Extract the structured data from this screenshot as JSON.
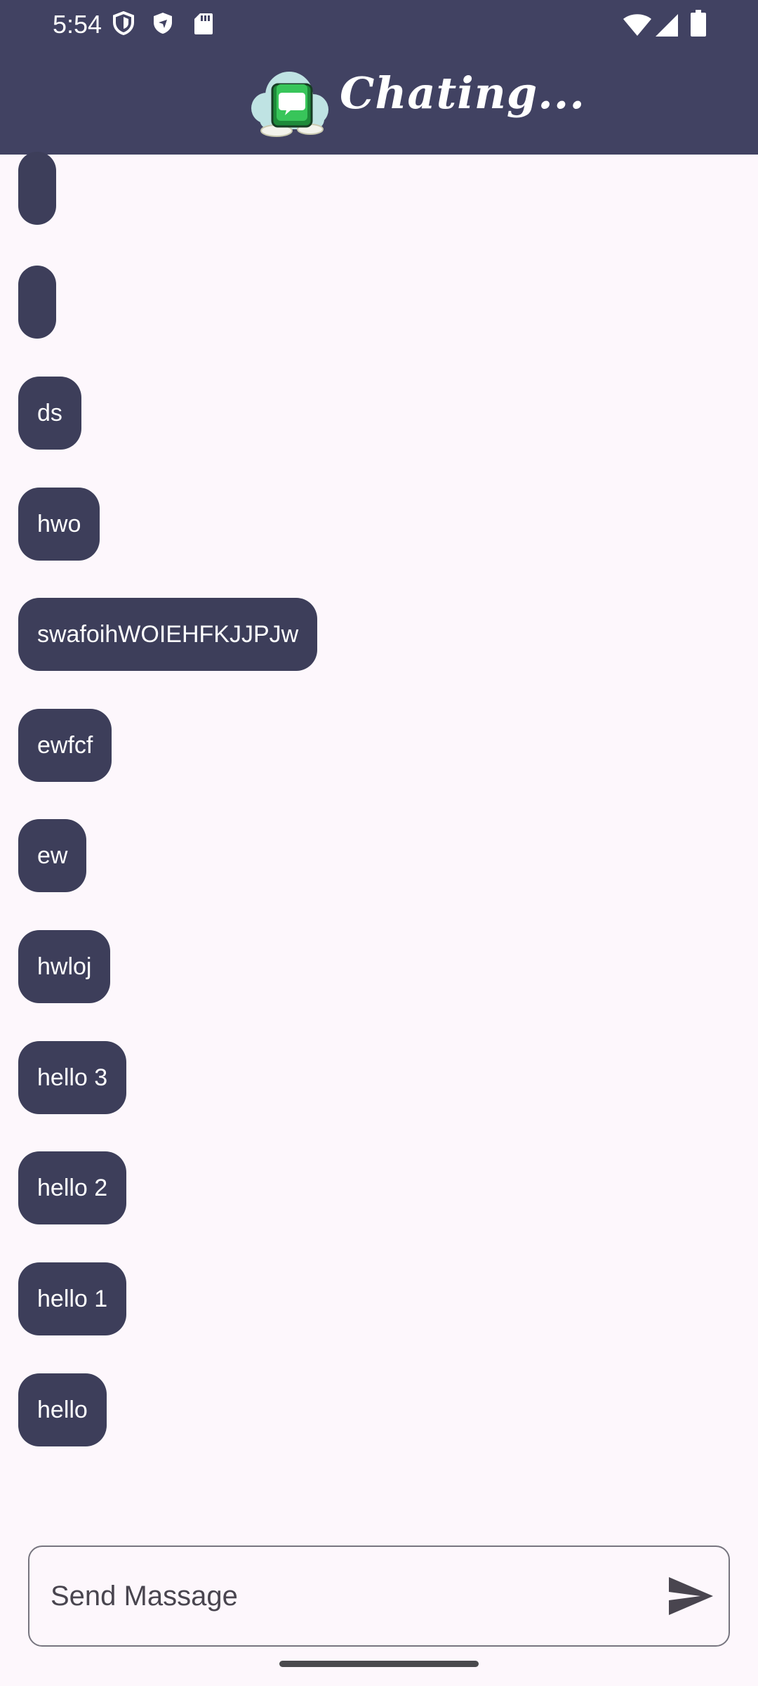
{
  "status_bar": {
    "time": "5:54",
    "icons": [
      "shield-outline-icon",
      "shield-filled-icon",
      "sd-card-icon",
      "wifi-icon",
      "signal-icon",
      "battery-icon"
    ]
  },
  "app_bar": {
    "title": "Chating...",
    "logo_icon": "chat-cloud-logo",
    "background": "#414262"
  },
  "messages": [
    {
      "text": ""
    },
    {
      "text": ""
    },
    {
      "text": "ds"
    },
    {
      "text": "hwo"
    },
    {
      "text": "swafoihWOIEHFKJJPJw"
    },
    {
      "text": "ewfcf"
    },
    {
      "text": "ew"
    },
    {
      "text": "hwloj"
    },
    {
      "text": "hello 3"
    },
    {
      "text": "hello 2"
    },
    {
      "text": "hello 1"
    },
    {
      "text": "hello"
    }
  ],
  "composer": {
    "placeholder": "Send Massage",
    "value": "",
    "send_icon": "send-icon"
  },
  "colors": {
    "bubble": "#3D3E5A",
    "background": "#FDF7FC"
  }
}
